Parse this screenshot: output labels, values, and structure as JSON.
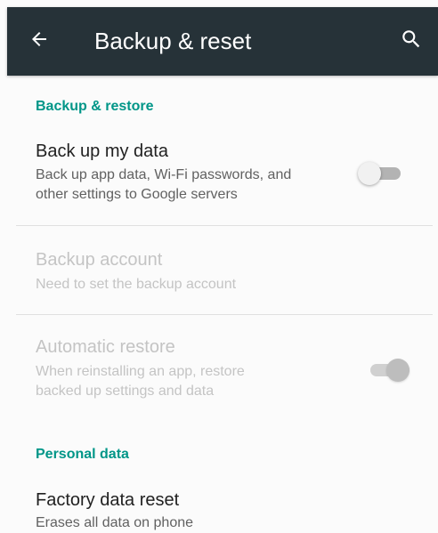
{
  "toolbar": {
    "title": "Backup & reset",
    "back_icon": "arrow-back-icon",
    "search_icon": "search-icon",
    "background_color": "#263238"
  },
  "sections": {
    "backup_restore": {
      "header": "Backup & restore",
      "back_up_my_data": {
        "title": "Back up my data",
        "summary_line1": "Back up app data, Wi-Fi passwords, and",
        "summary_line2": "other settings to Google servers",
        "switch_state": "off"
      },
      "backup_account": {
        "title": "Backup account",
        "summary": "Need to set the backup account",
        "state": "disabled"
      },
      "automatic_restore": {
        "title": "Automatic restore",
        "summary_line1": "When reinstalling an app, restore",
        "summary_line2": "backed up settings and data",
        "switch_state": "on",
        "state": "disabled"
      }
    },
    "personal_data": {
      "header": "Personal data",
      "factory_data_reset": {
        "title": "Factory data reset",
        "summary": "Erases all data on phone"
      }
    }
  },
  "colors": {
    "accent": "#009688",
    "background": "#fbfbfb",
    "primary_text": "#212121",
    "secondary_text": "#616161",
    "disabled_text": "#c4c4c4"
  }
}
